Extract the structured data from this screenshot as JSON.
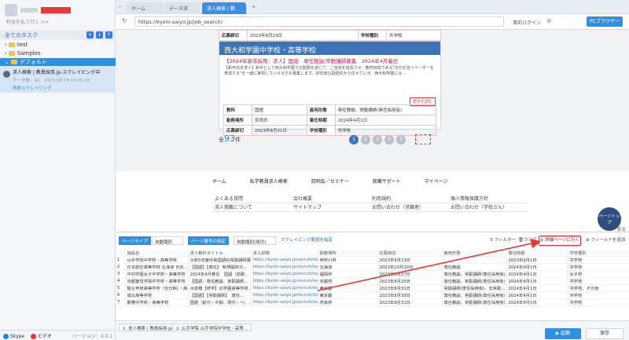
{
  "account": {
    "sub": "料金を払う行く >>"
  },
  "tasks": {
    "header": "全てのタスク",
    "folders": [
      "test",
      "Samples"
    ],
    "default": "デフォルト"
  },
  "task": {
    "title": "求人検索 | 教員採用.jp-スクレイピング中",
    "meta": "データ数：90　2023-08-18 14:05:18",
    "status": "再度スクレイピング"
  },
  "left_foot": {
    "skype": "Skype",
    "video": "ビデオ",
    "version": "バージョン：4.0.1"
  },
  "browser": {
    "tabs": [
      "ホーム",
      "データ求",
      "求人検索 | 教"
    ],
    "url": "https://kyoin-saiyo.jp/job_search/",
    "login": "事前ログイン",
    "pc_mode": "PCブラウザー"
  },
  "top_table": [
    [
      "応募締切",
      "2023年8月23日",
      "学校種別",
      "共学校"
    ]
  ],
  "card": {
    "school": "西大和学園中学校・高等学校",
    "subtitle": "【2024年新卒採用：求人】国語　専任教諭/常勤講師募集　2024年4月着任",
    "desc": "【新卒内定求人】新卒として西大和学園での勤務を通じて、ご自身を成長させ、教育目標である\"次代を担うリーダーを育成する\"を一緒に実現していける方を募集します。初年度は副担任から任せていき、西大和学園には…",
    "more": "続きを読む",
    "rows": [
      [
        "教科",
        "国語",
        "雇用形態",
        "専任教諭、常勤講師(専任採用有)"
      ],
      [
        "勤務場所",
        "奈良県",
        "着任時期",
        "2024年4月1日"
      ],
      [
        "応募締切",
        "2023年8月31日",
        "学校種別",
        "共学校"
      ]
    ]
  },
  "total": {
    "prefix": "全",
    "count": "93",
    "suffix": "件"
  },
  "pages": [
    "1",
    "2",
    "3",
    "4",
    "5"
  ],
  "footer_nav": [
    "ホーム",
    "私学教員求人検索",
    "説明会／セミナー",
    "就職サポート",
    "マイページ"
  ],
  "footer_links": [
    "よくある質問",
    "会社概要",
    "利用規約",
    "個人情報保護方針",
    "求人掲載について",
    "サイトマップ",
    "お問い合わせ（求職者）",
    "お問い合わせ（学校さん）"
  ],
  "pagetop": "ページトップ",
  "page_foot_label": "折る",
  "datapanel": {
    "page_type_label": "ページタイプ",
    "page_type_value": "自動識別",
    "pagination_label": "ページ番号の設定",
    "pagination_value": "自動識別(成功)",
    "scroll_link": "スクレイピング範囲を指定",
    "filter": "フィルター",
    "clear": "クリア",
    "go_detail": "詳細ページに行く",
    "add_field": "フィールドを追加",
    "headers": [
      "",
      "施設名",
      "求人教科タイトル",
      "求人詳細",
      "勤務場所",
      "応募締切",
      "雇用形態",
      "着任時期",
      "学校種別"
    ],
    "rows": [
      [
        "1",
        "山手学院中学校・高等学校",
        "令和5年度中高国語科常勤講師募",
        "https://kyoin-saiyo.jp/recruit/req…",
        "神奈川県",
        "2023年8月23日",
        "",
        "2023年9月1日",
        "共学校"
      ],
      [
        "2",
        "日本航空高等学校 北海道 日本…",
        "【国語】【専任】 新規開校の…",
        "https://kyoin-saiyo.jp/recruit/req…",
        "北海道",
        "2023年10月10日",
        "専任教諭",
        "2024年4月1日",
        "共学校"
      ],
      [
        "3",
        "中村学園女子中学校・高等学校",
        "2024年4月着任　国語（前勤…",
        "https://kyoin-saiyo.jp/recruit/req…",
        "福岡県",
        "2023年8月17日",
        "専任教諭、常勤講師(専任採用有)",
        "2024年4月1日",
        "女子校"
      ],
      [
        "4",
        "京都聖母学院中学校・高等学校",
        "【国語／専任教諭、常勤講師…",
        "https://kyoin-saiyo.jp/recruit/req…",
        "京都府",
        "2023年8月25日",
        "専任教諭、常勤講師(専任採用有)",
        "2024年4月1日",
        "共学校"
      ],
      [
        "5",
        "駿台甲府高等学校（全日制）・高等学校",
        "水道橋【修学】応学園高等学校…",
        "https://kyoin-saiyo.jp/recruit/req…",
        "東京都",
        "2023年8月31日",
        "常勤講師(専任採用有)、非常勤…",
        "2024年4月1日",
        "共学校、その他"
      ],
      [
        "6",
        "城北高等学校",
        "【国語】【常勤講師】　専任…",
        "https://kyoin-saiyo.jp/recruit/req…",
        "東京都",
        "2023年8月30日",
        "専任教諭、常勤講師(専任採用有)",
        "2024年4月1日",
        "共学校"
      ],
      [
        "7",
        "慶應中学校・高等学校",
        "国語（前代・中勤、現代・ベ）…",
        "https://kyoin-saiyo.jp/recruit/req…",
        "奈良県",
        "2023年8月31日",
        "専任教諭、常勤講師(専任採用有)",
        "2024年4月1日",
        "共学校"
      ]
    ]
  },
  "bottom": {
    "tab1": "1. 求人検索 | 教員採用.jp",
    "tab2": "2. 山手学院 山手学院中学校・高等…",
    "run": "起動",
    "save": "保存"
  },
  "colors": {
    "accent": "#2f8fe0",
    "card_header": "#3d74b8",
    "arrow": "#e53935"
  }
}
